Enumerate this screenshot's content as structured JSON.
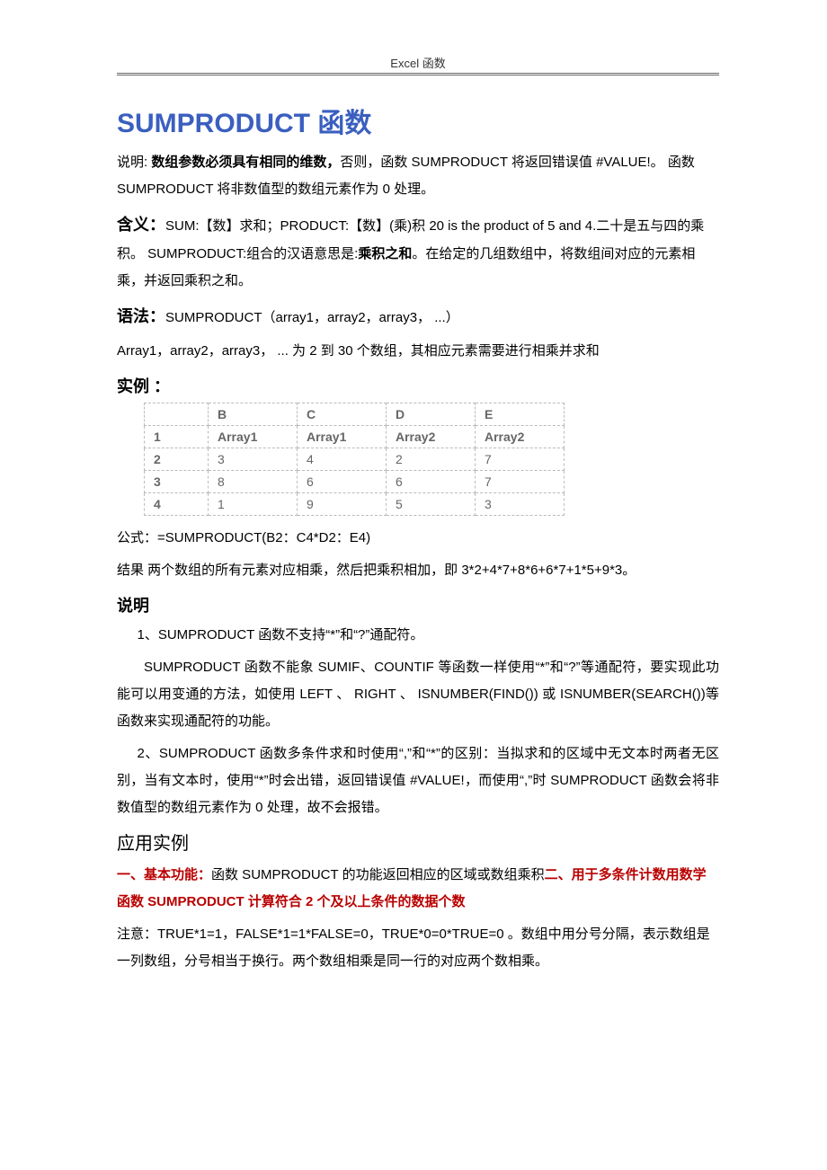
{
  "header": "Excel 函数",
  "title": "SUMPRODUCT 函数",
  "intro_label": "说明: ",
  "intro_bold": "数组参数必须具有相同的维数，",
  "intro_rest": "否则，函数 SUMPRODUCT 将返回错误值 #VALUE!。 函数 SUMPRODUCT 将非数值型的数组元素作为 0 处理。",
  "meaning_head": "含义：",
  "meaning_body1": "SUM:【数】求和；PRODUCT:【数】(乘)积 20 is the product of 5 and 4.二十是五与四的乘积。 SUMPRODUCT:组合的汉语意思是:",
  "meaning_bold": "乘积之和",
  "meaning_body2": "。在给定的几组数组中，将数组间对应的元素相乘，并返回乘积之和。",
  "syntax_head": "语法：",
  "syntax_body": "SUMPRODUCT（array1，array2，array3， ...）",
  "syntax_note": "Array1，array2，array3， ... 为 2 到 30 个数组，其相应元素需要进行相乘并求和",
  "example_head": "实例 ：",
  "table": {
    "header": [
      "",
      "B",
      "C",
      "D",
      "E"
    ],
    "rows": [
      [
        "1",
        "Array1",
        "Array1",
        "Array2",
        "Array2"
      ],
      [
        "2",
        "3",
        "4",
        "2",
        "7"
      ],
      [
        "3",
        "8",
        "6",
        "6",
        "7"
      ],
      [
        "4",
        "1",
        "9",
        "5",
        "3"
      ]
    ]
  },
  "formula_label": "公式：",
  "formula_body": "=SUMPRODUCT(B2：C4*D2：E4)",
  "result_label": "结果 ",
  "result_body": "两个数组的所有元素对应相乘，然后把乘积相加，即 3*2+4*7+8*6+6*7+1*5+9*3。",
  "note_head": "说明",
  "note1": "1、SUMPRODUCT 函数不支持“*”和“?”通配符。",
  "note1_body": "SUMPRODUCT 函数不能象 SUMIF、COUNTIF 等函数一样使用“*”和“?”等通配符，要实现此功能可以用变通的方法，如使用 LEFT 、 RIGHT 、 ISNUMBER(FIND()) 或 ISNUMBER(SEARCH())等函数来实现通配符的功能。",
  "note2": "2、SUMPRODUCT 函数多条件求和时使用“,”和“*”的区别：当拟求和的区域中无文本时两者无区别，当有文本时，使用“*”时会出错，返回错误值 #VALUE!，而使用“,”时 SUMPRODUCT 函数会将非数值型的数组元素作为 0 处理，故不会报错。",
  "app_head": "应用实例",
  "app1_label": "一、基本功能：",
  "app1_body": "函数 SUMPRODUCT 的功能返回相应的区域或数组乘积",
  "app2_label": "二、用于多条件计数用数学函数 SUMPRODUCT 计算符合 2 个及以上条件的数据个数",
  "app_note": "注意：TRUE*1=1，FALSE*1=1*FALSE=0，TRUE*0=0*TRUE=0 。数组中用分号分隔，表示数组是一列数组，分号相当于换行。两个数组相乘是同一行的对应两个数相乘。"
}
